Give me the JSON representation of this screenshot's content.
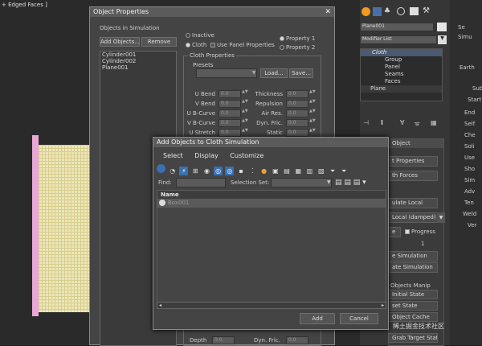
{
  "viewport": {
    "label": "+ Edged Faces ]"
  },
  "cmd_panel": {
    "object_name": "Plane001",
    "modifier_list": "Modifier List",
    "stack": [
      "Cloth",
      "Group",
      "Panel",
      "Seams",
      "Faces",
      "Plane"
    ],
    "rollout_header": "Object",
    "buttons": [
      "t Properties",
      "th Forces",
      "ulate Local",
      "Local (damped)",
      "e",
      "Progress",
      "1",
      "e Simulation",
      "ate Simulation",
      "Objects Manip",
      "Initial State",
      "set State",
      "Object Cache",
      "Grab Target State"
    ]
  },
  "right_strip": {
    "labels": [
      "Se",
      "Simu",
      "Earth",
      "Sub",
      "Start",
      "End",
      "Self",
      "Che",
      "Soli",
      "Use",
      "Sho",
      "Sim",
      "Adv",
      "Ten",
      "Weld",
      "Ver"
    ]
  },
  "obj_props": {
    "title": "Object Properties",
    "objects_label": "Objects in Simulation",
    "add_objects": "Add Objects...",
    "remove": "Remove",
    "objects": [
      "Cylinder001",
      "Cylinder002",
      "Plane001"
    ],
    "inactive": "Inactive",
    "cloth": "Cloth",
    "use_panel": "Use Panel Properties",
    "property1": "Property 1",
    "property2": "Property 2",
    "cloth_props": "Cloth Properties",
    "presets": "Presets",
    "load": "Load...",
    "save": "Save...",
    "params_left": [
      {
        "label": "U Bend",
        "value": "0.0"
      },
      {
        "label": "V Bend",
        "value": "0.0"
      },
      {
        "label": "U B-Curve",
        "value": "0.0"
      },
      {
        "label": "V B-Curve",
        "value": "0.0"
      },
      {
        "label": "U Stretch",
        "value": "0.0"
      }
    ],
    "params_right": [
      {
        "label": "Thickness",
        "value": "0.0"
      },
      {
        "label": "Repulsion",
        "value": "0.0"
      },
      {
        "label": "Air Res.",
        "value": "0.0"
      },
      {
        "label": "Dyn. Fric.",
        "value": "0.0"
      },
      {
        "label": "Static",
        "value": "0.0"
      }
    ],
    "bottom_params": [
      {
        "label": "Depth",
        "value": "0.0"
      },
      {
        "label": "Dyn. Fric.",
        "value": "0.0"
      }
    ]
  },
  "add_dlg": {
    "title": "Add Objects to Cloth Simulation",
    "menu": [
      "Select",
      "Display",
      "Customize"
    ],
    "find_label": "Find:",
    "selset_label": "Selection Set:",
    "column": "Name",
    "rows": [
      "Box001"
    ],
    "add": "Add",
    "cancel": "Cancel"
  },
  "watermark": "稀土掘金技术社区"
}
